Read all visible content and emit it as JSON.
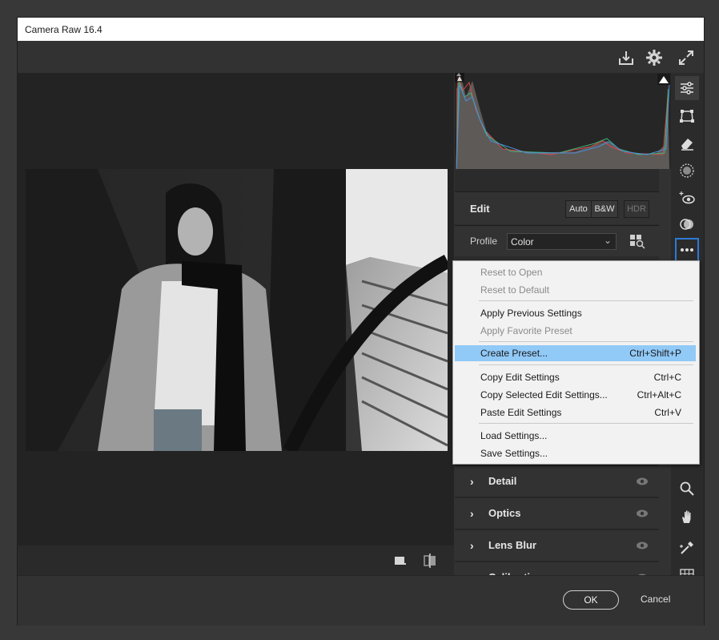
{
  "window": {
    "title": "Camera Raw 16.4"
  },
  "topbar": {
    "icons": [
      "save-download-icon",
      "gear-icon",
      "fullscreen-icon"
    ]
  },
  "edit": {
    "title": "Edit",
    "auto_label": "Auto",
    "bw_label": "B&W",
    "hdr_label": "HDR",
    "profile_label": "Profile",
    "profile_value": "Color"
  },
  "sections": [
    {
      "title": "Detail"
    },
    {
      "title": "Optics"
    },
    {
      "title": "Lens Blur"
    },
    {
      "title": "Calibration"
    }
  ],
  "context_menu": {
    "items": [
      {
        "label": "Reset to Open",
        "shortcut": "",
        "disabled": true
      },
      {
        "label": "Reset to Default",
        "shortcut": "",
        "disabled": true
      },
      {
        "label": "Apply Previous Settings",
        "shortcut": "",
        "disabled": false
      },
      {
        "label": "Apply Favorite Preset",
        "shortcut": "",
        "disabled": true
      },
      {
        "label": "Create Preset...",
        "shortcut": "Ctrl+Shift+P",
        "disabled": false,
        "highlighted": true
      },
      {
        "label": "Copy Edit Settings",
        "shortcut": "Ctrl+C",
        "disabled": false
      },
      {
        "label": "Copy Selected Edit Settings...",
        "shortcut": "Ctrl+Alt+C",
        "disabled": false
      },
      {
        "label": "Paste Edit Settings",
        "shortcut": "Ctrl+V",
        "disabled": false
      },
      {
        "label": "Load Settings...",
        "shortcut": "",
        "disabled": false
      },
      {
        "label": "Save Settings...",
        "shortcut": "",
        "disabled": false
      }
    ]
  },
  "tools": [
    "edit-sliders-icon",
    "crop-icon",
    "eraser-icon",
    "masking-icon",
    "red-eye-icon",
    "presets-icon",
    "more-icon",
    "zoom-icon",
    "hand-icon",
    "color-sampler-icon",
    "grid-icon"
  ],
  "footer": {
    "ok_label": "OK",
    "cancel_label": "Cancel"
  },
  "colors": {
    "accent": "#2d7ad6",
    "menu_highlight": "#91c9f7"
  }
}
